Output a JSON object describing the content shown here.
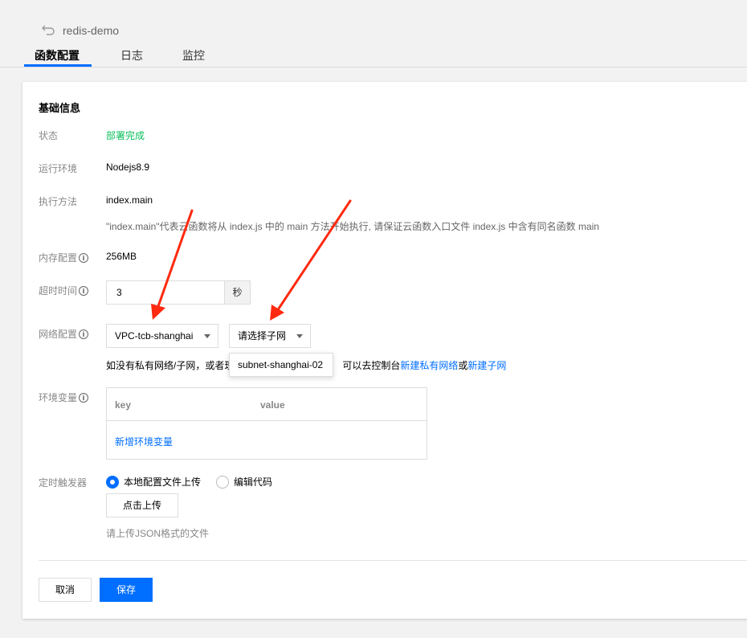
{
  "header": {
    "app_title": "redis-demo",
    "tabs": [
      {
        "label": "函数配置",
        "active": true
      },
      {
        "label": "日志",
        "active": false
      },
      {
        "label": "监控",
        "active": false
      }
    ]
  },
  "section": {
    "title": "基础信息"
  },
  "fields": {
    "status": {
      "label": "状态",
      "value": "部署完成"
    },
    "runtime": {
      "label": "运行环境",
      "value": "Nodejs8.9"
    },
    "handler": {
      "label": "执行方法",
      "value": "index.main",
      "hint": "\"index.main\"代表云函数将从 index.js 中的 main 方法开始执行, 请保证云函数入口文件 index.js 中含有同名函数 main"
    },
    "memory": {
      "label": "内存配置",
      "value": "256MB"
    },
    "timeout": {
      "label": "超时时间",
      "value": "3",
      "unit": "秒"
    },
    "network": {
      "label": "网络配置",
      "vpc_value": "VPC-tcb-shanghai",
      "subnet_placeholder": "请选择子网",
      "dropdown_option": "subnet-shanghai-02",
      "hint_prefix": "如没有私有网络/子网，或者现",
      "hint_middle": "可以去控制台",
      "link_vpc": "新建私有网络",
      "hint_or": "或",
      "link_subnet": "新建子网"
    },
    "env": {
      "label": "环境变量",
      "col_key": "key",
      "col_value": "value",
      "add_label": "新增环境变量"
    },
    "trigger": {
      "label": "定时触发器",
      "option_upload": "本地配置文件上传",
      "option_edit": "编辑代码",
      "upload_button": "点击上传",
      "hint": "请上传JSON格式的文件"
    }
  },
  "footer": {
    "cancel_label": "取消",
    "save_label": "保存"
  },
  "colors": {
    "accent": "#006eff",
    "success": "#0abf5b",
    "arrow": "#ff2a10"
  },
  "icons": {
    "back": "back-arrow-icon",
    "info": "info-circle-icon",
    "caret": "caret-down-icon"
  }
}
